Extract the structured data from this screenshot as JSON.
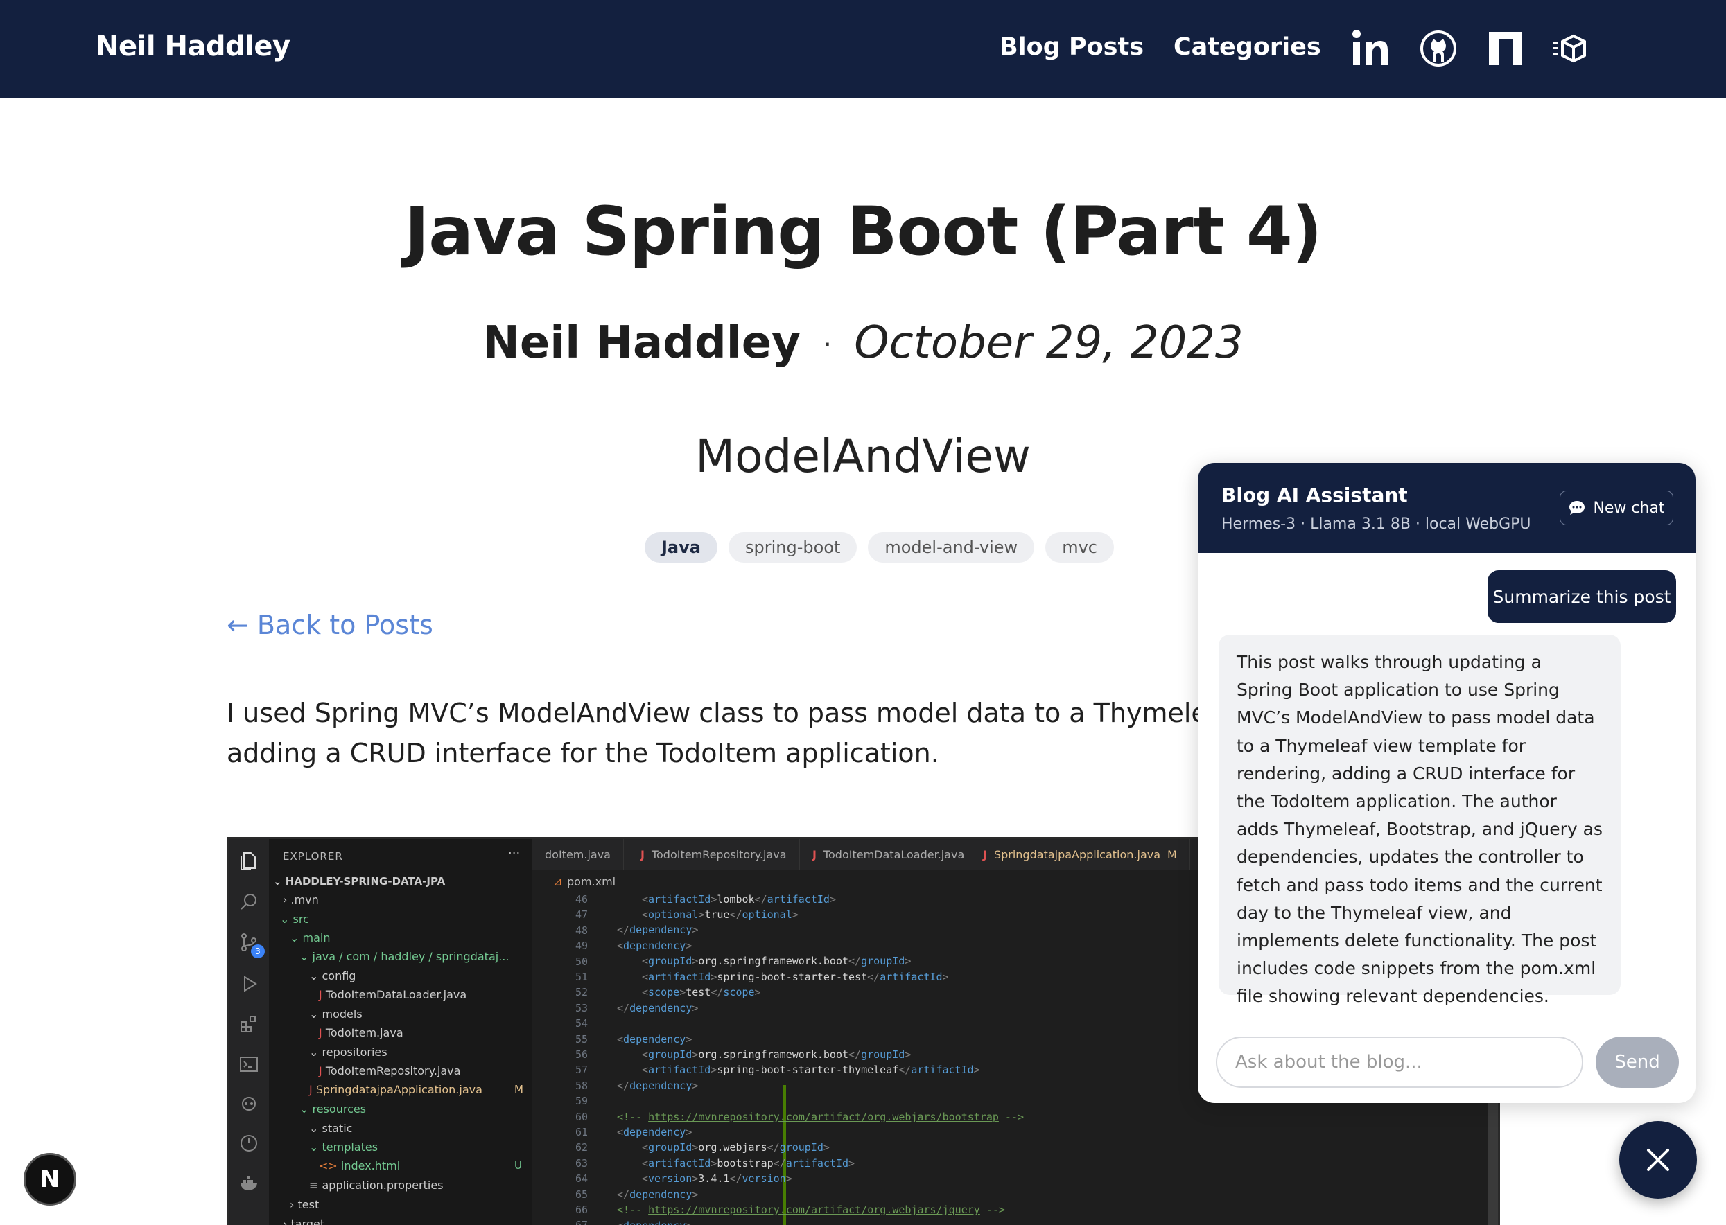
{
  "header": {
    "brand": "Neil Haddley",
    "nav": [
      {
        "label": "Blog Posts"
      },
      {
        "label": "Categories"
      }
    ],
    "social_icons": [
      "linkedin-icon",
      "github-icon",
      "notion-icon",
      "codesandbox-icon"
    ]
  },
  "post": {
    "title": "Java Spring Boot (Part 4)",
    "author": "Neil Haddley",
    "separator": "·",
    "date": "October 29, 2023",
    "subtitle": "ModelAndView",
    "tags": [
      "Java",
      "spring-boot",
      "model-and-view",
      "mvc"
    ],
    "back_link": "← Back to Posts",
    "intro_line1": "I used Spring MVC’s ModelAndView class to pass model data to a Thymeleaf view tem",
    "intro_line2": "adding a CRUD interface for the TodoItem application."
  },
  "editor": {
    "explorer_title": "EXPLORER",
    "project": "HADDLEY-SPRING-DATA-JPA",
    "tree": [
      ".mvn",
      "src",
      "main",
      "java / com / haddley / springdataj...",
      "config",
      "TodoItemDataLoader.java",
      "models",
      "TodoItem.java",
      "repositories",
      "TodoItemRepository.java",
      "SpringdatajpaApplication.java",
      "resources",
      "static",
      "templates",
      "index.html",
      "application.properties",
      "test",
      "target"
    ],
    "badges": {
      "mod": "M",
      "untracked": "U",
      "scm_count": "3"
    },
    "tabs": [
      {
        "label": "doItem.java"
      },
      {
        "label": "TodoItemRepository.java"
      },
      {
        "label": "TodoItemDataLoader.java"
      },
      {
        "label": "SpringdatajpaApplication.java",
        "status": "M"
      }
    ],
    "breadcrumb": "pom.xml",
    "line_numbers": [
      "46",
      "47",
      "48",
      "49",
      "50",
      "51",
      "52",
      "53",
      "54",
      "55",
      "56",
      "57",
      "58",
      "59",
      "60",
      "61",
      "62",
      "63",
      "64",
      "65",
      "66",
      "67"
    ],
    "code": {
      "l46": "lombok",
      "l47": "true",
      "l50": "org.springframework.boot",
      "l51": "spring-boot-starter-test",
      "l52": "test",
      "l56": "org.springframework.boot",
      "l57": "spring-boot-starter-thymeleaf",
      "url_bootstrap": "https://mvnrepository.com/artifact/org.webjars/bootstrap",
      "l62": "org.webjars",
      "l63": "bootstrap",
      "l64": "3.4.1",
      "url_jquery": "https://mvnrepository.com/artifact/org.webjars/jquery",
      "tag_artifactId": "artifactId",
      "tag_optional": "optional",
      "tag_dependency": "dependency",
      "tag_groupId": "groupId",
      "tag_scope": "scope",
      "tag_version": "version",
      "cm_open": "<!-- ",
      "cm_close": " -->"
    }
  },
  "chat": {
    "title": "Blog AI Assistant",
    "subtitle": "Hermes-3 · Llama 3.1 8B · local WebGPU",
    "new_chat": "New chat",
    "user_message": "Summarize this post",
    "bot_message": "This post walks through updating a Spring Boot application to use Spring MVC’s ModelAndView to pass model data to a Thymeleaf view template for rendering, adding a CRUD interface for the TodoItem application. The author adds Thymeleaf, Bootstrap, and jQuery as dependencies, updates the controller to fetch and pass todo items and the current day to the Thymeleaf view, and implements delete functionality. The post includes code snippets from the pom.xml file showing relevant dependencies.",
    "input_placeholder": "Ask about the blog...",
    "send": "Send"
  },
  "floating": {
    "next_badge": "N"
  }
}
